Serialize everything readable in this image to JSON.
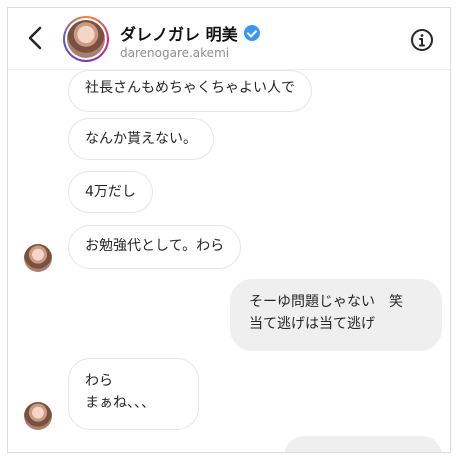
{
  "header": {
    "display_name": "ダレノガレ 明美",
    "username": "darenogare.akemi",
    "verified": true,
    "back_icon": "chevron-left-icon",
    "info_icon": "info-icon"
  },
  "messages": [
    {
      "direction": "incoming",
      "text": "社長さんもめちゃくちゃよい人で"
    },
    {
      "direction": "incoming",
      "text": "なんか貰えない。"
    },
    {
      "direction": "incoming",
      "text": "4万だし"
    },
    {
      "direction": "incoming",
      "text": "お勉強代として。わら",
      "show_avatar": true
    },
    {
      "direction": "outgoing",
      "text": "そーゆ問題じゃない　笑\n当て逃げは当て逃げ"
    },
    {
      "direction": "incoming",
      "text": "わら\nまぁね、、、",
      "show_avatar": true
    },
    {
      "direction": "outgoing",
      "text": ""
    }
  ],
  "colors": {
    "incoming_bubble": "#ffffff",
    "outgoing_bubble": "#efefef",
    "verified_badge": "#3897f0"
  }
}
